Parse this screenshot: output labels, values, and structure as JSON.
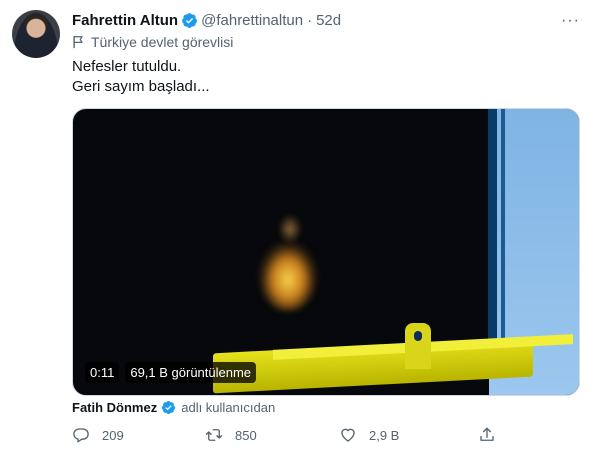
{
  "tweet": {
    "author_name": "Fahrettin Altun",
    "author_handle": "@fahrettinaltun",
    "separator": "·",
    "time": "52d",
    "more": "···",
    "label": "Türkiye devlet görevlisi",
    "text_lines": [
      "Nefesler tutuldu.",
      "Geri sayım başladı..."
    ]
  },
  "media": {
    "duration": "0:11",
    "views": "69,1 B görüntülenme"
  },
  "attribution": {
    "user": "Fatih Dönmez",
    "suffix": "adlı kullanıcıdan"
  },
  "actions": {
    "replies": "209",
    "retweets": "850",
    "likes": "2,9 B"
  },
  "colors": {
    "verified": "#1d9bf0",
    "secondary_text": "#536471",
    "primary_text": "#0f1419"
  },
  "icons": [
    "verified-badge-icon",
    "flag-icon",
    "reply-icon",
    "retweet-icon",
    "heart-icon",
    "share-icon"
  ]
}
